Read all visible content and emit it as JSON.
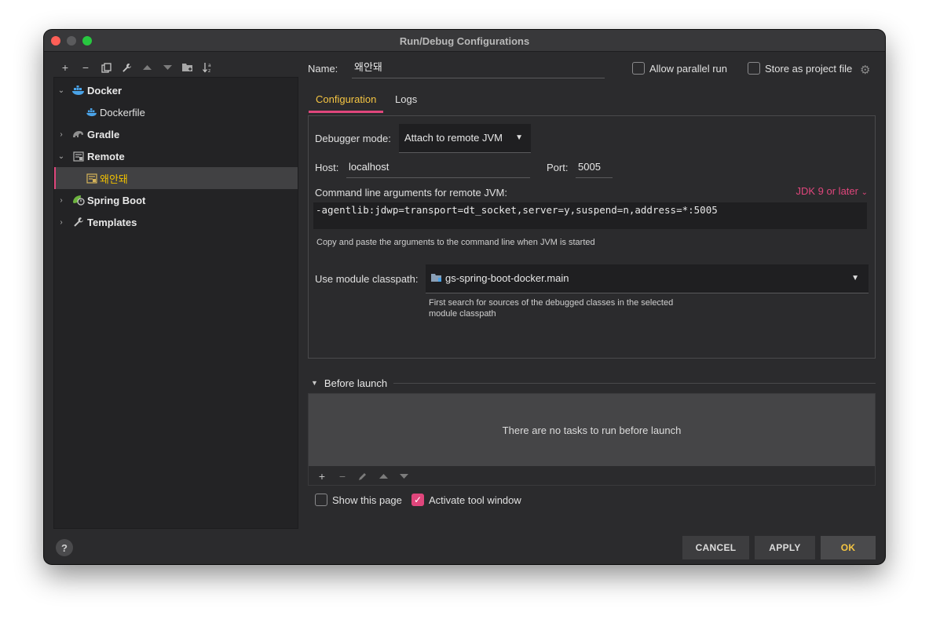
{
  "window": {
    "title": "Run/Debug Configurations"
  },
  "toolbar": {
    "add_icon": "+",
    "remove_icon": "−",
    "copy_icon": "⧉",
    "wrench_icon": "🔧",
    "up_icon": "▲",
    "down_icon": "▼",
    "folder_icon": "📁",
    "sort_icon": "⇅"
  },
  "tree": {
    "items": [
      {
        "label": "Docker",
        "bold": true
      },
      {
        "label": "Dockerfile",
        "bold": false
      },
      {
        "label": "Gradle",
        "bold": true
      },
      {
        "label": "Remote",
        "bold": true
      },
      {
        "label": "왜안돼",
        "bold": false
      },
      {
        "label": "Spring Boot",
        "bold": true
      },
      {
        "label": "Templates",
        "bold": true
      }
    ]
  },
  "header": {
    "name_label": "Name:",
    "name_value": "왜안돼",
    "allow_parallel_label": "Allow parallel run",
    "store_project_label": "Store as project file"
  },
  "tabs": [
    {
      "label": "Configuration"
    },
    {
      "label": "Logs"
    }
  ],
  "config": {
    "debugger_mode_label": "Debugger mode:",
    "debugger_mode_value": "Attach to remote JVM",
    "host_label": "Host:",
    "host_value": "localhost",
    "port_label": "Port:",
    "port_value": "5005",
    "cmd_label": "Command line arguments for remote JVM:",
    "jdk_link": "JDK 9 or later",
    "cmd_value": "-agentlib:jdwp=transport=dt_socket,server=y,suspend=n,address=*:5005",
    "cmd_hint": "Copy and paste the arguments to the command line when JVM is started",
    "module_label": "Use module classpath:",
    "module_value": "gs-spring-boot-docker.main",
    "module_hint_1": "First search for sources of the debugged classes in the selected",
    "module_hint_2": "module classpath"
  },
  "before_launch": {
    "title": "Before launch",
    "empty_text": "There are no tasks to run before launch"
  },
  "options": {
    "show_page_label": "Show this page",
    "show_page_checked": false,
    "activate_tool_label": "Activate tool window",
    "activate_tool_checked": true
  },
  "buttons": {
    "cancel": "CANCEL",
    "apply": "APPLY",
    "ok": "OK",
    "help": "?"
  },
  "colors": {
    "accent": "#e0467c",
    "tab_active_text": "#f5c542",
    "background": "#2b2b2d"
  }
}
